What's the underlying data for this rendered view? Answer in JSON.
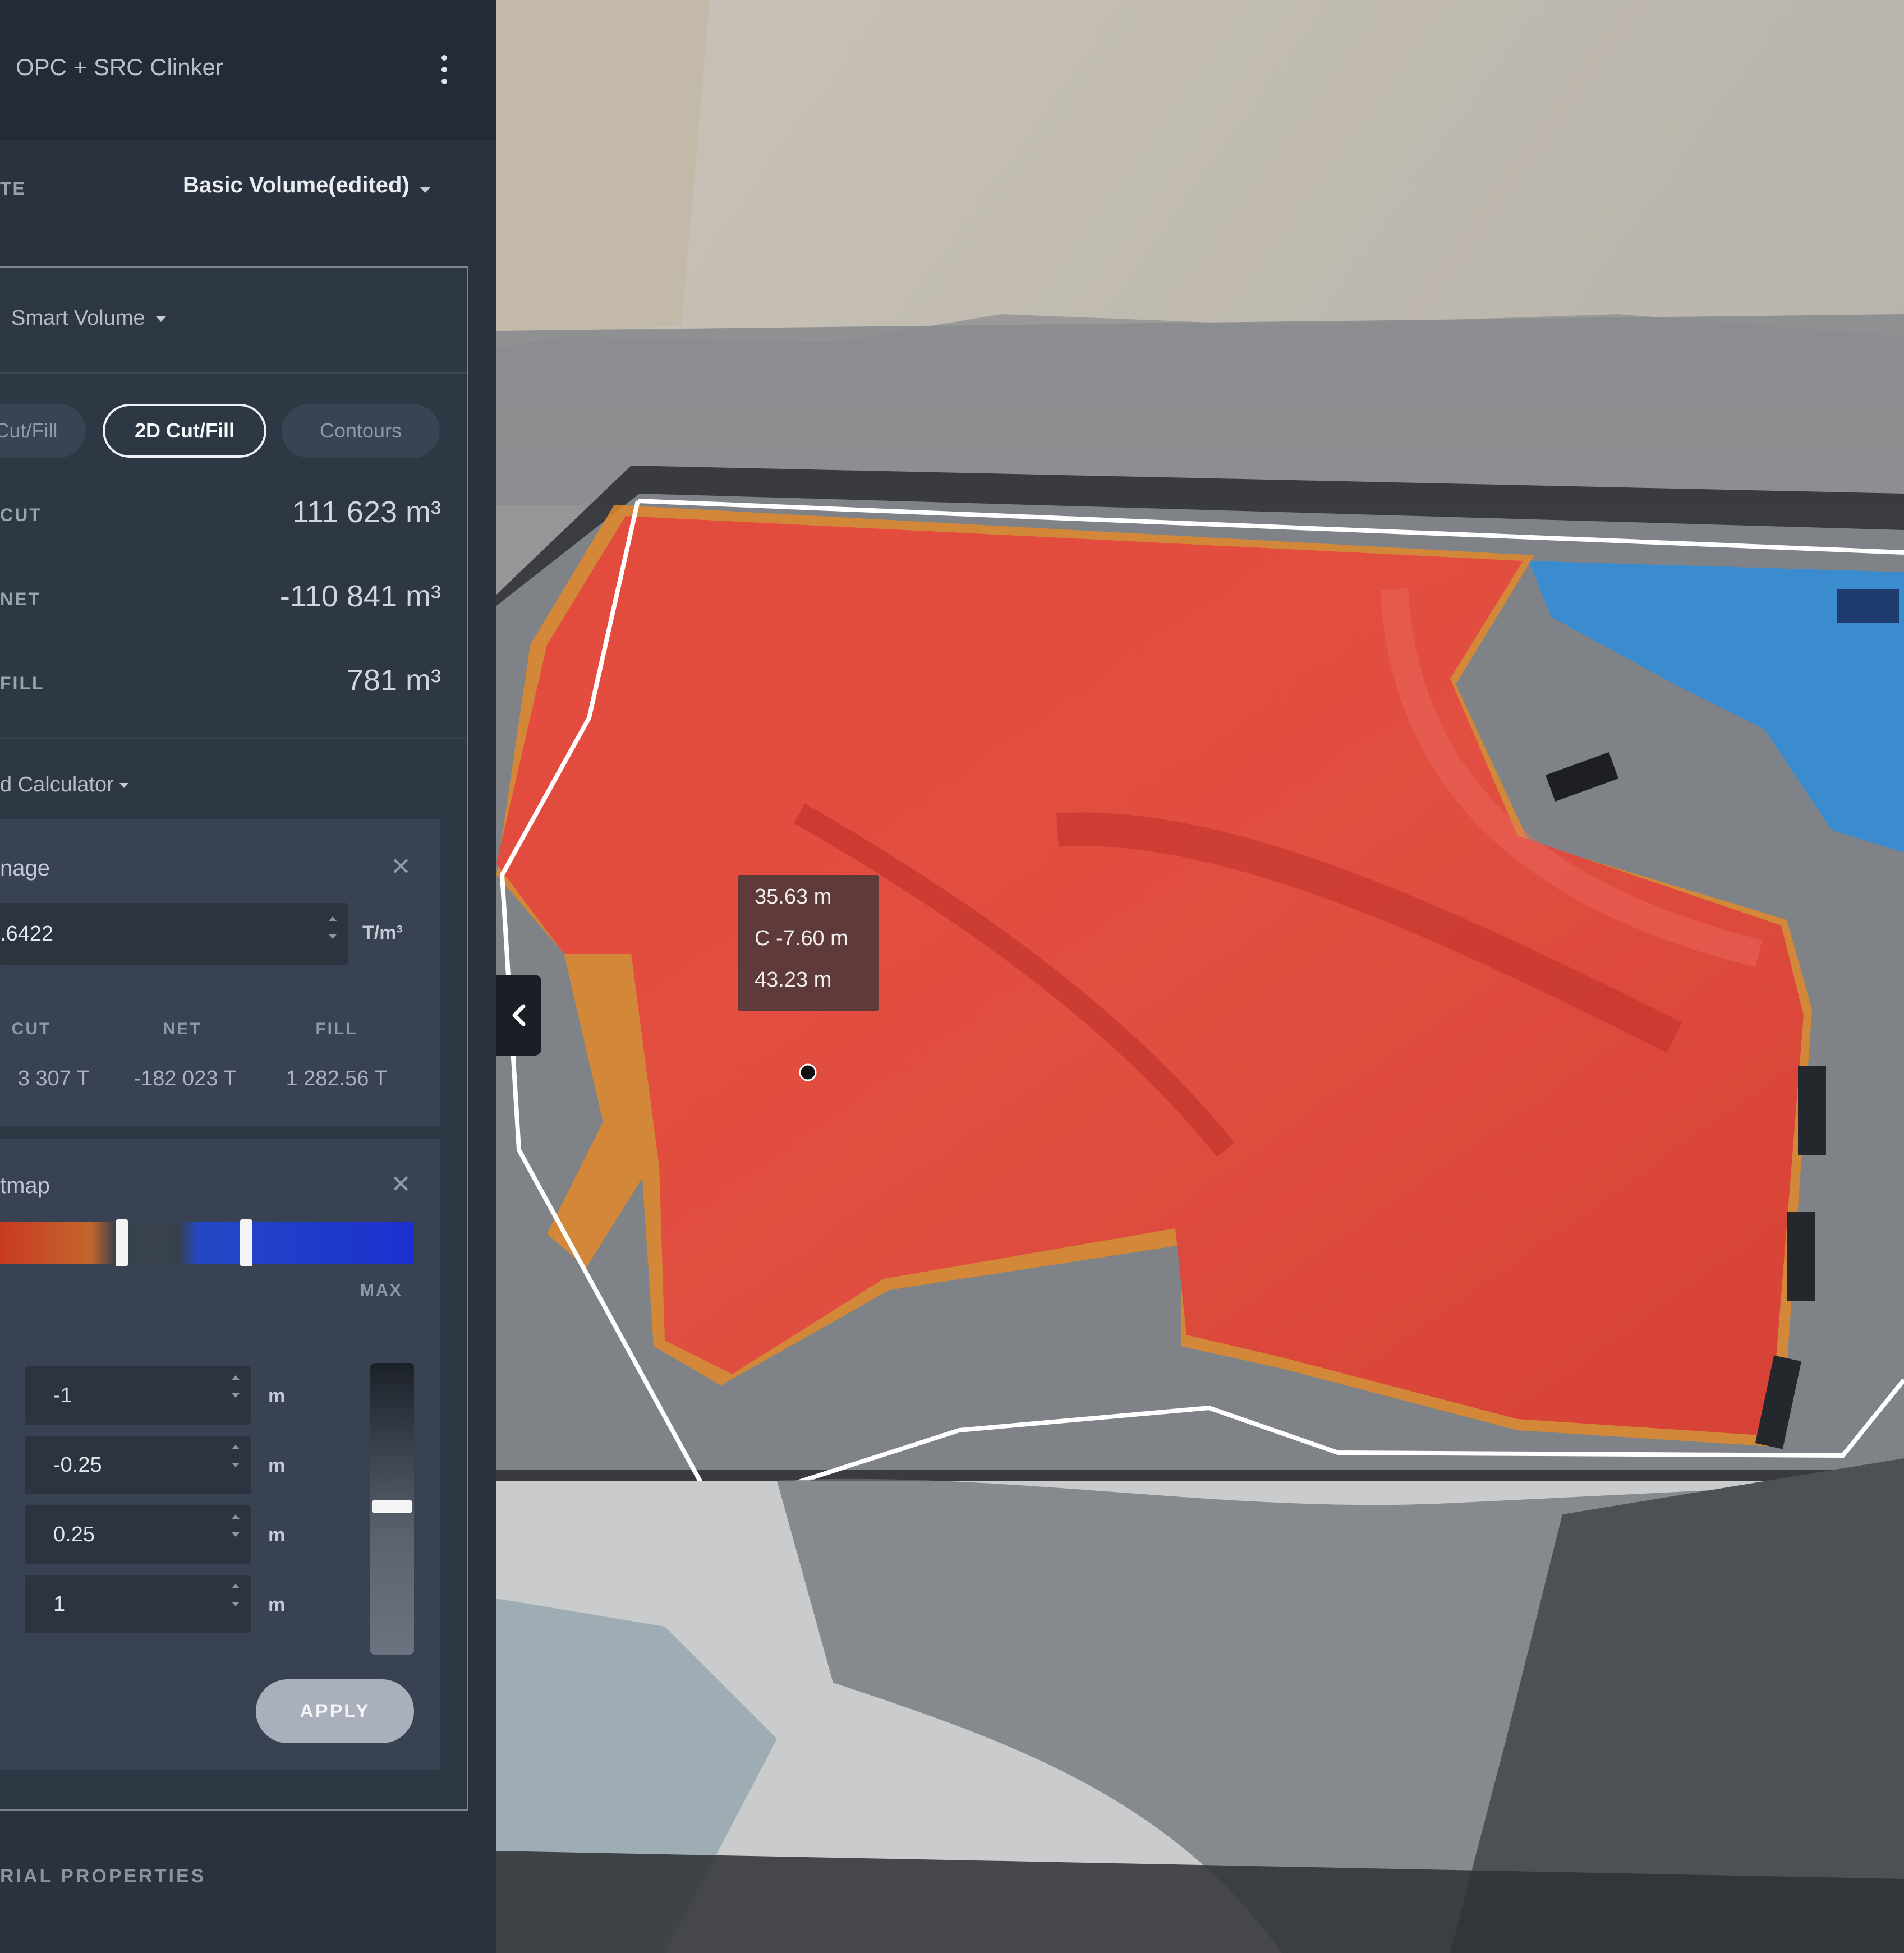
{
  "header": {
    "title": "OPC + SRC Clinker",
    "menu_icon": "kebab-menu-icon"
  },
  "template": {
    "label": "TE",
    "value": "Basic Volume(edited)"
  },
  "mode": {
    "value": "Smart Volume"
  },
  "tabs": [
    {
      "label": "Cut/Fill",
      "active": false
    },
    {
      "label": "2D Cut/Fill",
      "active": true
    },
    {
      "label": "Contours",
      "active": false
    }
  ],
  "stats": [
    {
      "label": "CUT",
      "value": "111 623 m³"
    },
    {
      "label": "NET",
      "value": "-110 841 m³"
    },
    {
      "label": "FILL",
      "value": "781 m³"
    }
  ],
  "calculator": {
    "label": "d Calculator"
  },
  "tonnage": {
    "title": "nage",
    "density_value": ".6422",
    "density_unit": "T/m³",
    "columns": [
      {
        "label": "CUT",
        "value": "3 307 T"
      },
      {
        "label": "NET",
        "value": "-182 023 T"
      },
      {
        "label": "FILL",
        "value": "1 282.56 T"
      }
    ]
  },
  "heatmap": {
    "title": "tmap",
    "max_label": "MAX",
    "thresholds": [
      {
        "value": "-1",
        "unit": "m"
      },
      {
        "value": "-0.25",
        "unit": "m"
      },
      {
        "value": "0.25",
        "unit": "m"
      },
      {
        "value": "1",
        "unit": "m"
      }
    ],
    "apply_label": "APPLY",
    "colors": {
      "cut": "#c8391f",
      "fill": "#1c2fcf"
    }
  },
  "footer": {
    "label": "RIAL PROPERTIES"
  },
  "map": {
    "tooltip": {
      "line1": "35.63 m",
      "line2": "C -7.60 m",
      "line3": "43.23 m"
    },
    "colors": {
      "cut_overlay": "#e8403c",
      "fill_overlay": "#2a8fe0",
      "boundary": "#ffffff"
    }
  }
}
